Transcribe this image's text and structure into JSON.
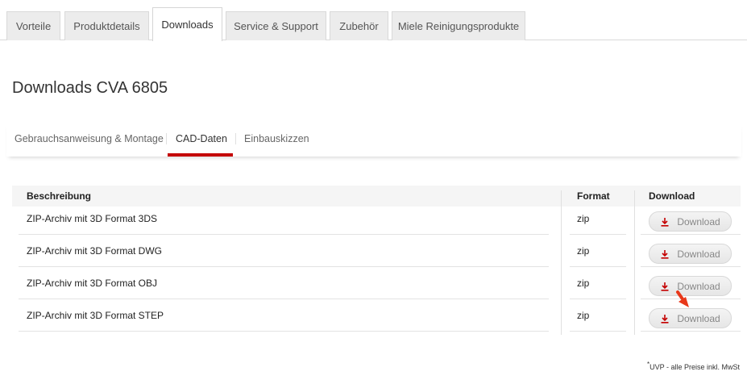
{
  "top_tabs": [
    {
      "label": "Vorteile"
    },
    {
      "label": "Produktdetails"
    },
    {
      "label": "Downloads",
      "active": true
    },
    {
      "label": "Service & Support"
    },
    {
      "label": "Zubehör"
    },
    {
      "label": "Miele Reinigungsprodukte"
    }
  ],
  "page_title": "Downloads CVA 6805",
  "sub_tabs": [
    {
      "label": "Gebrauchsanweisung & Montage"
    },
    {
      "label": "CAD-Daten",
      "active": true
    },
    {
      "label": "Einbauskizzen"
    }
  ],
  "table": {
    "headers": {
      "description": "Beschreibung",
      "format": "Format",
      "download": "Download"
    },
    "rows": [
      {
        "description": "ZIP-Archiv mit 3D Format 3DS",
        "format": "zip",
        "button": "Download"
      },
      {
        "description": "ZIP-Archiv mit 3D Format DWG",
        "format": "zip",
        "button": "Download"
      },
      {
        "description": "ZIP-Archiv mit 3D Format OBJ",
        "format": "zip",
        "button": "Download"
      },
      {
        "description": "ZIP-Archiv mit 3D Format STEP",
        "format": "zip",
        "button": "Download"
      }
    ]
  },
  "footnote": {
    "mark": "*",
    "text": "UVP - alle Preise inkl. MwSt"
  },
  "colors": {
    "accent": "#c40000",
    "download_icon": "#c40000"
  }
}
